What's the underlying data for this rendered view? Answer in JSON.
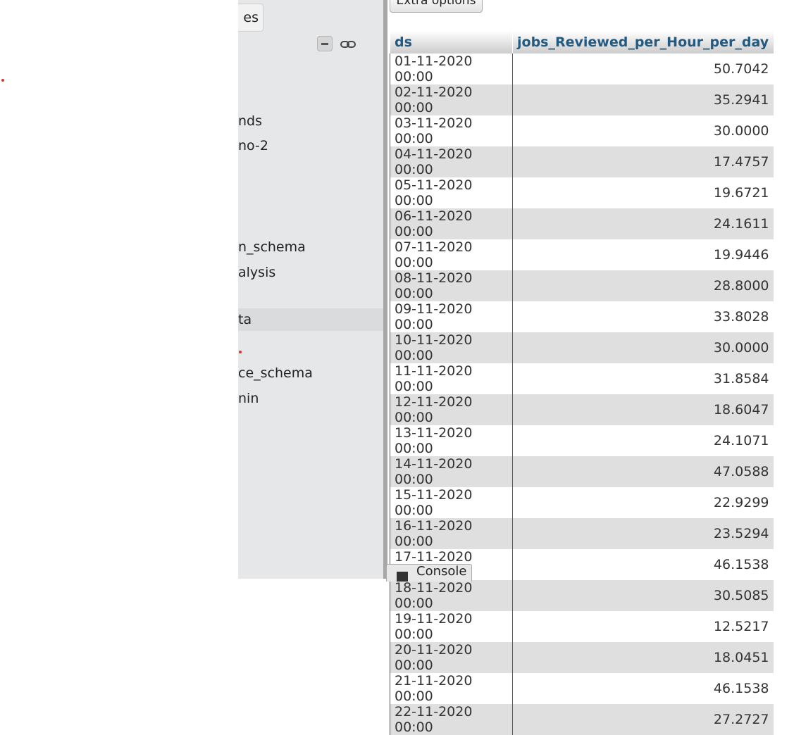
{
  "nav": {
    "top_button_label": "es",
    "items": [
      {
        "label": "nds"
      },
      {
        "label": "no-2"
      },
      {
        "label": "n_schema"
      },
      {
        "label": "alysis"
      },
      {
        "label": "ta"
      },
      {
        "label": "ce_schema"
      },
      {
        "label": "nin"
      }
    ]
  },
  "toolbar": {
    "extra_options_label": "Extra options"
  },
  "results": {
    "headers": [
      "ds",
      "jobs_Reviewed_per_Hour_per_day"
    ],
    "rows": [
      [
        "01-11-2020 00:00",
        "50.7042"
      ],
      [
        "02-11-2020 00:00",
        "35.2941"
      ],
      [
        "03-11-2020 00:00",
        "30.0000"
      ],
      [
        "04-11-2020 00:00",
        "17.4757"
      ],
      [
        "05-11-2020 00:00",
        "19.6721"
      ],
      [
        "06-11-2020 00:00",
        "24.1611"
      ],
      [
        "07-11-2020 00:00",
        "19.9446"
      ],
      [
        "08-11-2020 00:00",
        "28.8000"
      ],
      [
        "09-11-2020 00:00",
        "33.8028"
      ],
      [
        "10-11-2020 00:00",
        "30.0000"
      ],
      [
        "11-11-2020 00:00",
        "31.8584"
      ],
      [
        "12-11-2020 00:00",
        "18.6047"
      ],
      [
        "13-11-2020 00:00",
        "24.1071"
      ],
      [
        "14-11-2020 00:00",
        "47.0588"
      ],
      [
        "15-11-2020 00:00",
        "22.9299"
      ],
      [
        "16-11-2020 00:00",
        "23.5294"
      ],
      [
        "17-11-2020 00:00",
        "46.1538"
      ],
      [
        "18-11-2020 00:00",
        "30.5085"
      ],
      [
        "19-11-2020 00:00",
        "12.5217"
      ],
      [
        "20-11-2020 00:00",
        "18.0451"
      ],
      [
        "21-11-2020 00:00",
        "46.1538"
      ],
      [
        "22-11-2020 00:00",
        "27.2727"
      ]
    ]
  },
  "console": {
    "label": "Console"
  },
  "colors": {
    "header_text": "#235a81",
    "nav_background": "#e6e7e9",
    "row_alt": "#dfdfdf"
  }
}
